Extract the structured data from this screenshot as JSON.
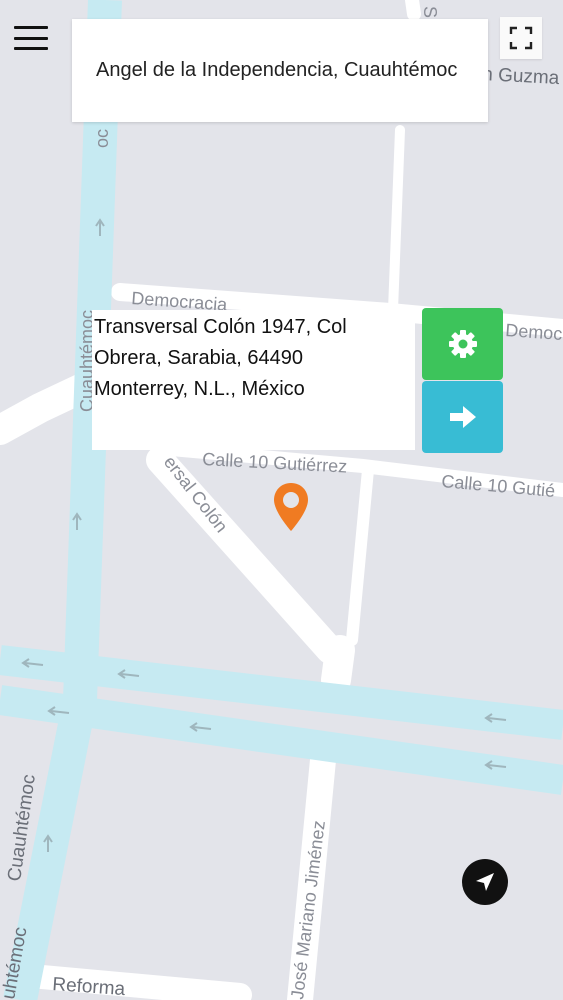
{
  "search": {
    "value": "Angel de la Independencia, Cuauhtémoc"
  },
  "address_card": {
    "lines": [
      "Transversal Colón 1947, Col",
      "Obrera, Sarabia, 64490",
      "Monterrey, N.L., México"
    ]
  },
  "map": {
    "streets": {
      "democracia": "Democracia",
      "democracia_right": "Democ",
      "calle_gutierrez": "Calle 10 Gutiérrez",
      "calle_gutierrez_right": "Calle 10 Gutié",
      "transversal": "ersal Colón",
      "cuauhtemoc_top": "oc",
      "cuauhtemoc_mid": "Cuauhtémoc",
      "cuauhtemoc_low": "Cuauhtémoc",
      "cuauhtemoc_bottom": "uhtémoc",
      "jose_mariano": "José Mariano Jiménez",
      "reforma": "Reforma",
      "guzman": "n Guzma",
      "top_street": "S"
    },
    "colors": {
      "background": "#e3e4ea",
      "major_road": "#c6eaf2",
      "minor_road": "#ffffff",
      "marker": "#f07b22"
    }
  },
  "icons": {
    "menu": "menu-icon",
    "fullscreen": "fullscreen-icon",
    "settings": "gear-icon",
    "go": "arrow-right-icon",
    "locate": "navigation-arrow-icon",
    "marker": "map-pin-icon"
  }
}
